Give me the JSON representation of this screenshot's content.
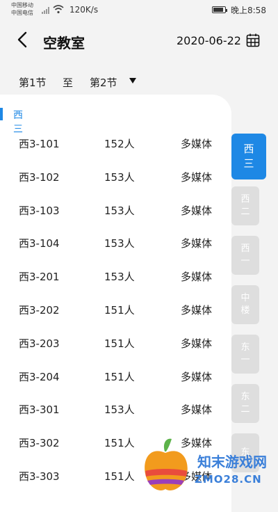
{
  "status_bar": {
    "carrier_1": "中国移动",
    "carrier_2": "中国电信",
    "net_speed": "120K/s",
    "time": "晚上8:58",
    "battery_level": 0.88
  },
  "header": {
    "back_icon": "chevron-left-icon",
    "title": "空教室",
    "date": "2020-06-22",
    "calendar_icon": "calendar-icon"
  },
  "filter": {
    "start_period": "第1节",
    "to_label": "至",
    "end_period": "第2节",
    "dropdown_icon": "triangle-down-icon"
  },
  "section": {
    "name": "西三",
    "accent": "#1e88e5"
  },
  "rooms": [
    {
      "room": "西3-101",
      "capacity": "152人",
      "type": "多媒体"
    },
    {
      "room": "西3-102",
      "capacity": "153人",
      "type": "多媒体"
    },
    {
      "room": "西3-103",
      "capacity": "153人",
      "type": "多媒体"
    },
    {
      "room": "西3-104",
      "capacity": "153人",
      "type": "多媒体"
    },
    {
      "room": "西3-201",
      "capacity": "153人",
      "type": "多媒体"
    },
    {
      "room": "西3-202",
      "capacity": "151人",
      "type": "多媒体"
    },
    {
      "room": "西3-203",
      "capacity": "151人",
      "type": "多媒体"
    },
    {
      "room": "西3-204",
      "capacity": "151人",
      "type": "多媒体"
    },
    {
      "room": "西3-301",
      "capacity": "153人",
      "type": "多媒体"
    },
    {
      "room": "西3-302",
      "capacity": "151人",
      "type": "多媒体"
    },
    {
      "room": "西3-303",
      "capacity": "151人",
      "type": "多媒体"
    }
  ],
  "buildings": [
    {
      "l1": "西",
      "l2": "三",
      "active": true
    },
    {
      "l1": "西",
      "l2": "二",
      "active": false
    },
    {
      "l1": "西",
      "l2": "一",
      "active": false
    },
    {
      "l1": "中",
      "l2": "楼",
      "active": false
    },
    {
      "l1": "东",
      "l2": "一",
      "active": false
    },
    {
      "l1": "东",
      "l2": "二",
      "active": false
    },
    {
      "l1": "东",
      "l2": "",
      "active": false
    }
  ],
  "watermark": {
    "line1": "知末游戏网",
    "line2": "ZMO28.CN"
  }
}
